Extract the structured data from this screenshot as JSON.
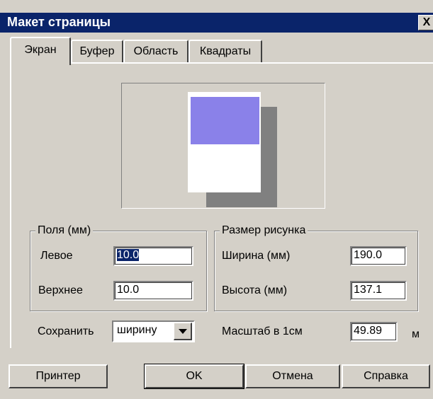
{
  "window": {
    "title": "Макет страницы",
    "close_label": "X"
  },
  "tabs": [
    {
      "label": "Экран",
      "active": true
    },
    {
      "label": "Буфер",
      "active": false
    },
    {
      "label": "Область",
      "active": false
    },
    {
      "label": "Квадраты",
      "active": false
    }
  ],
  "preview": {
    "picture_color": "#8a81e9"
  },
  "margins": {
    "legend": "Поля (мм)",
    "left_label": "Левое",
    "left_value": "10.0",
    "top_label": "Верхнее",
    "top_value": "10.0"
  },
  "size": {
    "legend": "Размер рисунка",
    "width_label": "Ширина (мм)",
    "width_value": "190.0",
    "height_label": "Высота (мм)",
    "height_value": "137.1"
  },
  "save": {
    "label": "Сохранить",
    "value": "ширину"
  },
  "scale": {
    "label": "Масштаб в 1см",
    "value": "49.89",
    "unit": "м"
  },
  "buttons": {
    "printer": "Принтер",
    "ok": "OK",
    "cancel": "Отмена",
    "help": "Справка"
  }
}
